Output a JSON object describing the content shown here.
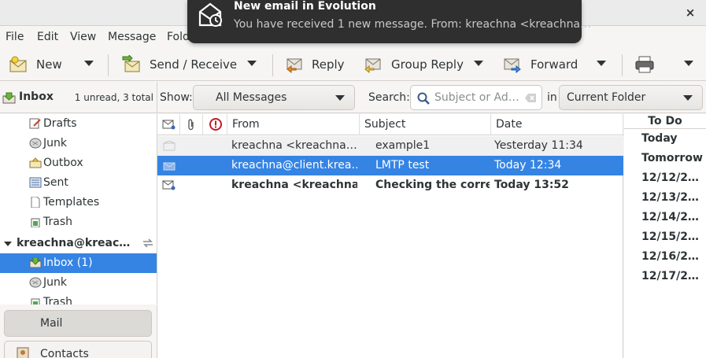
{
  "window": {
    "close_glyph": "×"
  },
  "notification": {
    "title": "New email in Evolution",
    "body": "You have received 1 new message. From: kreachna <kreachna…",
    "icon": "mail-clock-icon"
  },
  "menu": [
    "File",
    "Edit",
    "View",
    "Message",
    "Fold"
  ],
  "toolbar": {
    "new": "New",
    "send_receive": "Send / Receive",
    "reply": "Reply",
    "group_reply": "Group Reply",
    "forward": "Forward"
  },
  "folder_header": {
    "name": "Inbox",
    "count": "1 unread, 3 total"
  },
  "filter": {
    "show_label": "Show:",
    "show_value": "All Messages",
    "search_label": "Search:",
    "search_placeholder": "Subject or Ad…",
    "in_label": "in",
    "scope_value": "Current Folder"
  },
  "folders_local": [
    "Drafts",
    "Junk",
    "Outbox",
    "Sent",
    "Templates",
    "Trash"
  ],
  "account": {
    "name": "kreachna@kreac…",
    "folders": [
      "Inbox (1)",
      "Junk",
      "Trash"
    ]
  },
  "switcher": {
    "mail": "Mail",
    "contacts": "Contacts"
  },
  "columns": {
    "from": "From",
    "subject": "Subject",
    "date": "Date"
  },
  "messages": [
    {
      "from": "kreachna <kreachna…",
      "subject": "example1",
      "date": "Yesterday 11:34"
    },
    {
      "from": "kreachna@client.krea…",
      "subject": "LMTP test",
      "date": "Today 12:34"
    },
    {
      "from": "kreachna <kreachna…",
      "subject": "Checking the corre…",
      "date": "Today 13:52"
    }
  ],
  "todo": {
    "title": "To Do",
    "items": [
      "Today",
      "Tomorrow",
      "12/12/2…",
      "12/13/2…",
      "12/14/2…",
      "12/15/2…",
      "12/16/2…",
      "12/17/2…"
    ]
  },
  "colors": {
    "selection": "#3584e4",
    "notification_bg": "#2f2f2f"
  }
}
